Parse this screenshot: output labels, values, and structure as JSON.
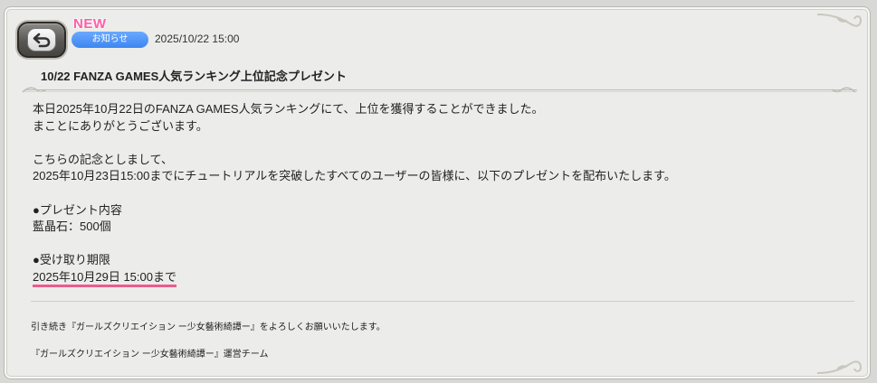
{
  "header": {
    "new_label": "NEW",
    "category_badge": "お知らせ",
    "date": "2025/10/22 15:00",
    "title": "10/22 FANZA GAMES人気ランキング上位記念プレゼント"
  },
  "body": {
    "line1": "本日2025年10月22日のFANZA GAMES人気ランキングにて、上位を獲得することができました。",
    "line2": "まことにありがとうございます。",
    "line3": "こちらの記念としまして、",
    "line4": "2025年10月23日15:00までにチュートリアルを突破したすべてのユーザーの皆様に、以下のプレゼントを配布いたします。",
    "present_heading": "●プレゼント内容",
    "present_item": "藍晶石：500個",
    "deadline_heading": "●受け取り期限",
    "deadline_value": "2025年10月29日 15:00まで"
  },
  "footer": {
    "line1": "引き続き『ガールズクリエイション ー少女藝術綺譚ー』をよろしくお願いいたします。",
    "line2": "『ガールズクリエイション ー少女藝術綺譚ー』運営チーム"
  },
  "colors": {
    "badge": "#3d86f0",
    "new_label": "#ff5da8",
    "deadline_underline": "#ea5c8d"
  },
  "icons": {
    "back": "return-arrow-icon"
  }
}
